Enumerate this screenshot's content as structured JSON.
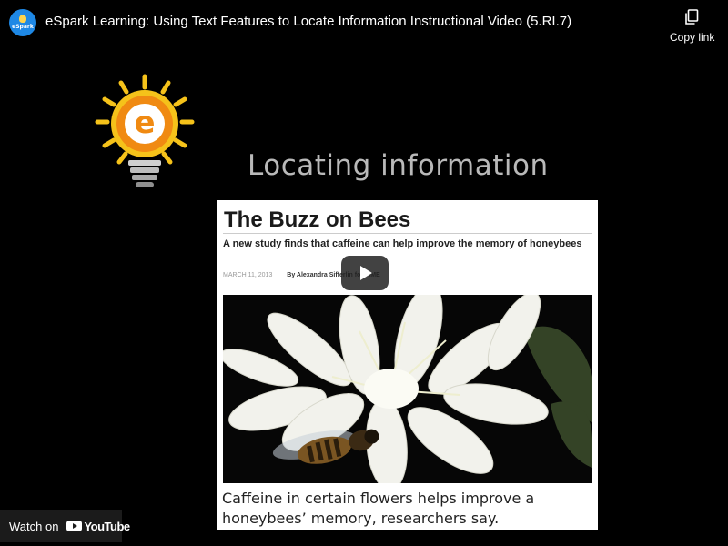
{
  "header": {
    "channel_avatar_text": "eSpark",
    "video_title": "eSpark Learning: Using Text Features to Locate Information Instructional Video (5.RI.7)",
    "copy_link_label": "Copy link"
  },
  "slide": {
    "heading": "Locating information",
    "article": {
      "title": "The Buzz on Bees",
      "subtitle": "A new study finds that caffeine can help improve the memory of honeybees",
      "date": "MARCH 11, 2013",
      "byline": "By Alexandra Sifferlin for TIME",
      "caption": "Caffeine in certain flowers helps improve a honeybees’ memory, researchers say."
    }
  },
  "footer": {
    "watch_on_label": "Watch on",
    "youtube_label": "YouTube"
  },
  "colors": {
    "background": "#000000",
    "avatar_blue": "#1e88e5",
    "bulb_yellow": "#f5c21a",
    "bulb_orange": "#f08a12",
    "heading_gray": "#b9b9b9",
    "play_button": "#212121"
  },
  "icons": {
    "copy": "copy-icon",
    "play": "play-icon",
    "logo": "lightbulb-logo"
  }
}
